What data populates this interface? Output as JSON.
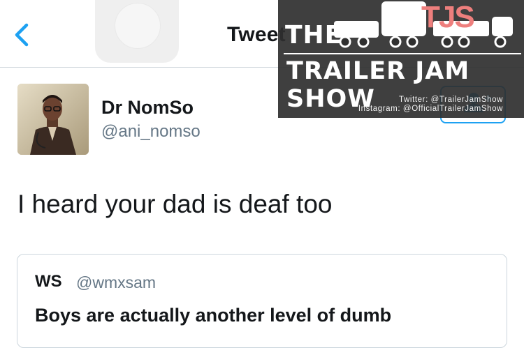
{
  "header": {
    "title": "Tweet"
  },
  "tweet": {
    "author_name": "Dr NomSo",
    "author_handle": "@ani_nomso",
    "text": "I heard your dad is deaf too"
  },
  "quoted_tweet": {
    "author_name": "WS",
    "author_handle": "@wmxsam",
    "text": "Boys are actually another level of dumb"
  },
  "watermark": {
    "word_the": "THE",
    "logo_letters": "TJS",
    "show_name": "TRAILER JAM SHOW",
    "twitter_line": "Twitter: @TrailerJamShow",
    "instagram_line": "Instagram: @OfficialTrailerJamShow"
  },
  "icons": [
    "back-chevron-icon",
    "add-user-icon",
    "truck-icon"
  ],
  "colors": {
    "accent": "#1da1f2",
    "secondary_text": "#657786",
    "divider": "#cfd6db",
    "watermark_bg": "#2f2f2f",
    "logo_pink": "#ee7f7d"
  }
}
